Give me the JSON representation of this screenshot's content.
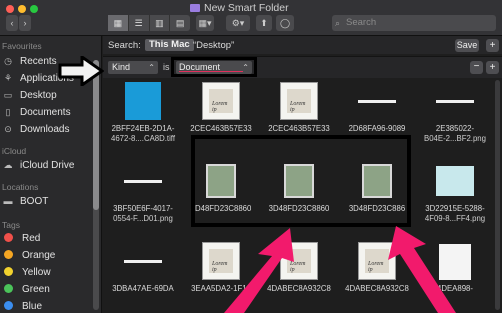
{
  "window": {
    "title": "New Smart Folder",
    "search_placeholder": "Search"
  },
  "toolbar": {
    "back": "‹",
    "forward": "›",
    "views": [
      "▦",
      "☰",
      "▥",
      "▤"
    ],
    "group": "▦▾",
    "action": "⚙▾",
    "share": "⬆",
    "tag": "◯"
  },
  "sidebar": {
    "favourites_header": "Favourites",
    "favourites": [
      {
        "label": "Recents",
        "icon": "clock-icon"
      },
      {
        "label": "Applications",
        "icon": "applications-icon"
      },
      {
        "label": "Desktop",
        "icon": "desktop-icon"
      },
      {
        "label": "Documents",
        "icon": "document-icon"
      },
      {
        "label": "Downloads",
        "icon": "downloads-icon"
      }
    ],
    "icloud_header": "iCloud",
    "icloud": [
      {
        "label": "iCloud Drive",
        "icon": "cloud-icon"
      }
    ],
    "locations_header": "Locations",
    "locations": [
      {
        "label": "BOOT",
        "icon": "disk-icon"
      }
    ],
    "tags_header": "Tags",
    "tags": [
      {
        "label": "Red",
        "color": "#f0504a"
      },
      {
        "label": "Orange",
        "color": "#f5a623"
      },
      {
        "label": "Yellow",
        "color": "#f2d22e"
      },
      {
        "label": "Green",
        "color": "#4bc35a"
      },
      {
        "label": "Blue",
        "color": "#3b8ef0"
      }
    ]
  },
  "search": {
    "label": "Search:",
    "scope_selected": "This Mac",
    "scope_other": "“Desktop”",
    "save": "Save",
    "add": "+"
  },
  "criteria": {
    "attribute": "Kind",
    "operator": "is",
    "value": "Document",
    "remove": "−",
    "add": "+"
  },
  "files": [
    {
      "line1": "2BFF24EB-2D1A-",
      "line2": "4672-8....CA8D.tiff",
      "thumb": "blue"
    },
    {
      "line1": "2CEC463B57E33",
      "line2": "",
      "thumb": "doc"
    },
    {
      "line1": "2CEC463B57E33",
      "line2": "",
      "thumb": "doc"
    },
    {
      "line1": "2D68FA96-9089",
      "line2": "",
      "thumb": "line"
    },
    {
      "line1": "2E385022-",
      "line2": "B04E-2...BF2.png",
      "thumb": "line"
    },
    {
      "line1": "3BF50E6F-4017-",
      "line2": "0554-F...D01.png",
      "thumb": "line"
    },
    {
      "line1": "3D48FD23C8860",
      "line2": "",
      "thumb": "green"
    },
    {
      "line1": "3D48FD23C8860",
      "line2": "",
      "thumb": "green"
    },
    {
      "line1": "3D48FD23C886",
      "line2": "",
      "thumb": "green"
    },
    {
      "line1": "3D22915E-5288-",
      "line2": "4F09-8...FF4.png",
      "thumb": "lightblue"
    },
    {
      "line1": "3DBA47AE-69DA",
      "line2": "",
      "thumb": "line"
    },
    {
      "line1": "3EAA5DA2-1F18",
      "line2": "",
      "thumb": "doc"
    },
    {
      "line1": "4DABEC8A932C8",
      "line2": "",
      "thumb": "doc"
    },
    {
      "line1": "4DABEC8A932C8",
      "line2": "",
      "thumb": "doc"
    },
    {
      "line1": "4DEA898-",
      "line2": "",
      "thumb": "apple"
    }
  ],
  "thumb_text": "Lorem ip"
}
